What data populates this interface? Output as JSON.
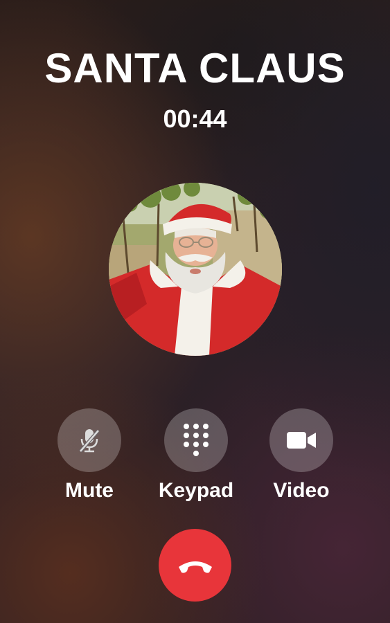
{
  "call": {
    "contact_name": "SANTA CLAUS",
    "duration": "00:44"
  },
  "avatar": {
    "icon": "santa-claus-photo"
  },
  "actions": [
    {
      "label": "Mute",
      "icon": "mic-off-icon"
    },
    {
      "label": "Keypad",
      "icon": "keypad-icon"
    },
    {
      "label": "Video",
      "icon": "video-camera-icon"
    }
  ],
  "end_call": {
    "icon": "end-call-icon",
    "color": "#e8353a"
  },
  "colors": {
    "text": "#ffffff",
    "button_fill": "rgba(255,255,255,0.24)",
    "end_call": "#e8353a"
  }
}
